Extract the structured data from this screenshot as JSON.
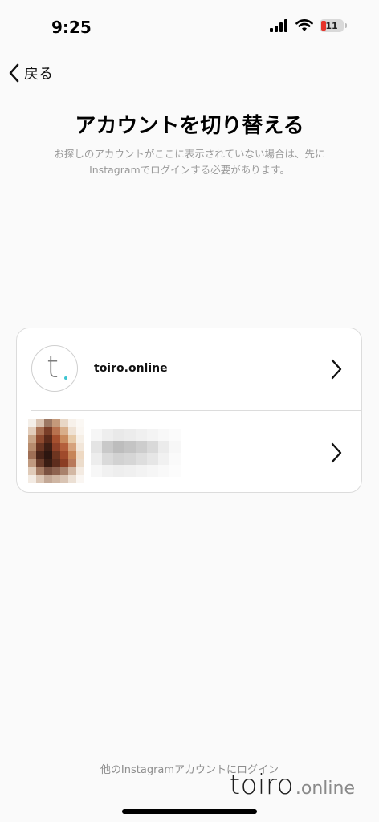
{
  "status_bar": {
    "time": "9:25",
    "battery_level": "11",
    "battery_color": "#e5342b"
  },
  "nav": {
    "back_label": "戻る",
    "back_icon": "chevron-left-icon"
  },
  "header": {
    "title": "アカウントを切り替える",
    "subtitle_line1": "お探しのアカウントがここに表示されていない場合は、先に",
    "subtitle_line2": "Instagramでログインする必要があります。"
  },
  "accounts": [
    {
      "username": "toiro.online",
      "avatar_icon": "toiro-logo-avatar",
      "chevron_icon": "chevron-right-icon"
    },
    {
      "username": "",
      "avatar_icon": "blurred-avatar",
      "chevron_icon": "chevron-right-icon"
    }
  ],
  "footer": {
    "login_other_label": "他のInstagramアカウントにログイン"
  },
  "watermark": {
    "main": "toiro",
    "sub": ".online"
  },
  "colors": {
    "background": "#fafafa",
    "accent_dot": "#3ec5d1",
    "muted_text": "#9a9a9a"
  }
}
